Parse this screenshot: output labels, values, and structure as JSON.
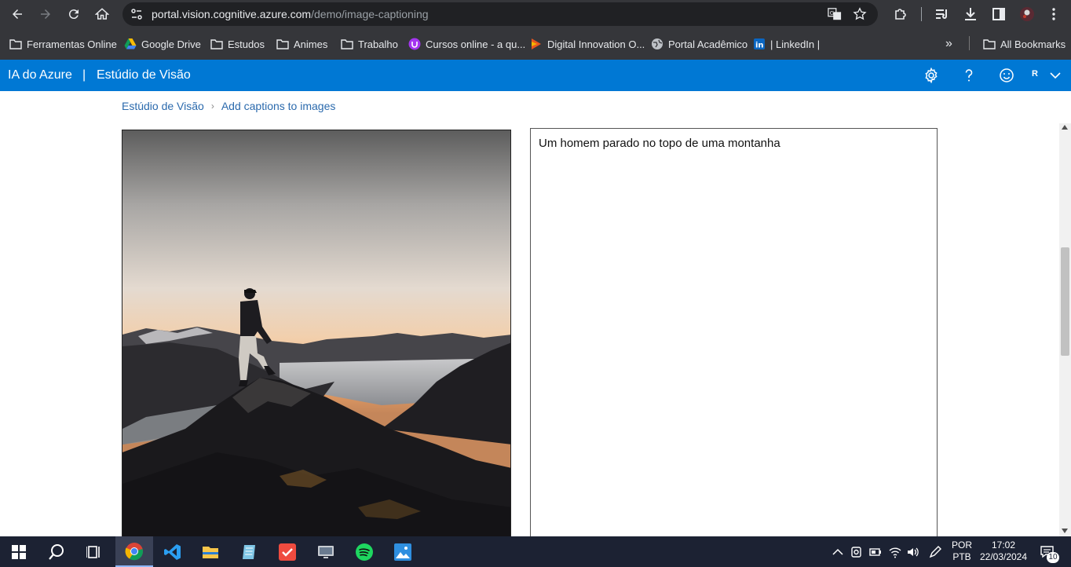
{
  "browser": {
    "url_domain": "portal.vision.cognitive.azure.com",
    "url_path": "/demo/image-captioning",
    "bookmarks": [
      {
        "label": "Ferramentas Online",
        "icon": "folder-icon"
      },
      {
        "label": "Google Drive",
        "icon": "google-drive-icon"
      },
      {
        "label": "Estudos",
        "icon": "folder-icon"
      },
      {
        "label": "Animes",
        "icon": "folder-icon"
      },
      {
        "label": "Trabalho",
        "icon": "folder-icon"
      },
      {
        "label": "Cursos online - a qu...",
        "icon": "udemy-icon"
      },
      {
        "label": "Digital Innovation O...",
        "icon": "dio-icon"
      },
      {
        "label": "Portal Acadêmico",
        "icon": "globe-icon"
      },
      {
        "label": "| LinkedIn |",
        "icon": "linkedin-icon"
      }
    ],
    "all_bookmarks": "All Bookmarks",
    "overflow": "»"
  },
  "azure": {
    "brand": "IA do Azure",
    "divider": "|",
    "product": "Estúdio de Visão",
    "avatar": "R",
    "accent": "#0078d4"
  },
  "page": {
    "breadcrumb": [
      "Estúdio de Visão",
      "Add captions to images"
    ],
    "caption": "Um homem parado no topo de uma montanha"
  },
  "taskbar": {
    "language": "POR",
    "layout": "PTB",
    "time": "17:02",
    "date": "22/03/2024",
    "notifications": "10"
  }
}
